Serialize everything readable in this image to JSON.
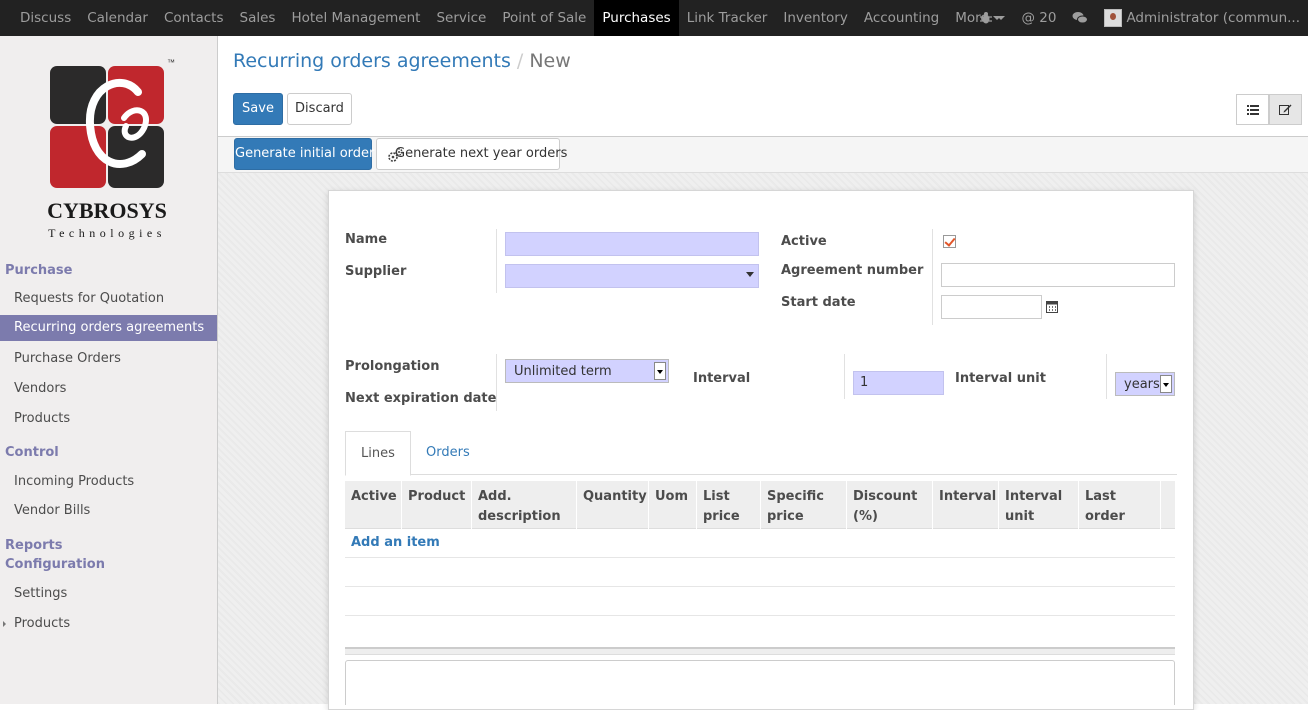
{
  "topbar": {
    "menu": [
      "Discuss",
      "Calendar",
      "Contacts",
      "Sales",
      "Hotel Management",
      "Service",
      "Point of Sale",
      "Purchases",
      "Link Tracker",
      "Inventory",
      "Accounting",
      "More"
    ],
    "active_menu": "Purchases",
    "messages_count": "@ 20",
    "user": "Administrator (commun..."
  },
  "logo": {
    "name": "CYBROSYS",
    "tagline": "Technologies",
    "tm": "™"
  },
  "sidebar": {
    "purchase_section": "Purchase",
    "requests_for_quotation": "Requests for Quotation",
    "recurring_orders": "Recurring orders agreements",
    "purchase_orders": "Purchase Orders",
    "vendors": "Vendors",
    "products": "Products",
    "control_section": "Control",
    "incoming_products": "Incoming Products",
    "vendor_bills": "Vendor Bills",
    "reports_section": "Reports",
    "configuration_section": "Configuration",
    "settings": "Settings",
    "config_products": "Products"
  },
  "breadcrumb": {
    "parent": "Recurring orders agreements",
    "separator": "/",
    "current": "New"
  },
  "buttons": {
    "save": "Save",
    "discard": "Discard",
    "generate_initial": "Generate initial order",
    "generate_next": "Generate next year orders"
  },
  "form": {
    "name_label": "Name",
    "supplier_label": "Supplier",
    "active_label": "Active",
    "agreement_number_label": "Agreement number",
    "start_date_label": "Start date",
    "prolongation_label": "Prolongation",
    "prolongation_value": "Unlimited term",
    "next_expiration_label": "Next expiration date",
    "interval_label": "Interval",
    "interval_value": "1",
    "interval_unit_label": "Interval unit",
    "interval_unit_value": "years"
  },
  "tabs": {
    "lines": "Lines",
    "orders": "Orders"
  },
  "table": {
    "headers": [
      "Active",
      "Product",
      "Add. description",
      "Quantity",
      "Uom",
      "List price",
      "Specific price",
      "Discount (%)",
      "Interval",
      "Interval unit",
      "Last order"
    ],
    "add_item": "Add an item"
  },
  "colors": {
    "accent": "#7c7bad",
    "primary": "#337ab7",
    "required": "#d2d2ff"
  }
}
